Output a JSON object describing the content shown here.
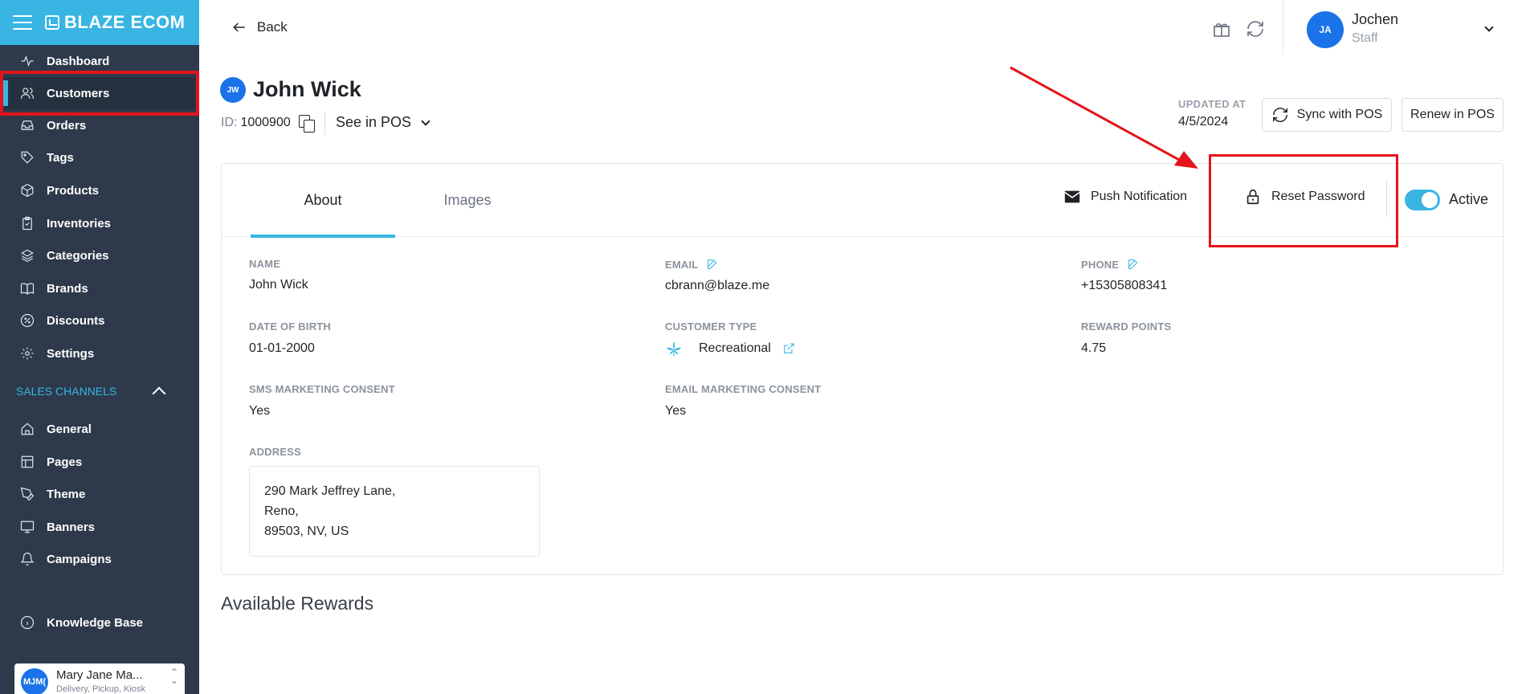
{
  "sidebar": {
    "brand": "BLAZE ECOM",
    "items": [
      {
        "label": "Dashboard",
        "icon": "activity-icon"
      },
      {
        "label": "Customers",
        "icon": "users-icon"
      },
      {
        "label": "Orders",
        "icon": "inbox-icon"
      },
      {
        "label": "Tags",
        "icon": "tag-icon"
      },
      {
        "label": "Products",
        "icon": "box-icon"
      },
      {
        "label": "Inventories",
        "icon": "clipboard-icon"
      },
      {
        "label": "Categories",
        "icon": "layers-icon"
      },
      {
        "label": "Brands",
        "icon": "book-icon"
      },
      {
        "label": "Discounts",
        "icon": "percent-icon"
      },
      {
        "label": "Settings",
        "icon": "gear-icon"
      }
    ],
    "section_label": "SALES CHANNELS",
    "channel_items": [
      {
        "label": "General",
        "icon": "home-icon"
      },
      {
        "label": "Pages",
        "icon": "layout-icon"
      },
      {
        "label": "Theme",
        "icon": "pen-icon"
      },
      {
        "label": "Banners",
        "icon": "monitor-icon"
      },
      {
        "label": "Campaigns",
        "icon": "bell-icon"
      }
    ],
    "knowledge_base": "Knowledge Base",
    "store": {
      "initials": "MJM(",
      "name": "Mary Jane Ma...",
      "subtitle": "Delivery, Pickup, Kiosk"
    }
  },
  "topbar": {
    "back_label": "Back",
    "user": {
      "initials": "JA",
      "name": "Jochen",
      "role": "Staff"
    }
  },
  "customer": {
    "initials": "JW",
    "name": "John Wick",
    "id_label": "ID:",
    "id_value": "1000900",
    "see_in_pos": "See in POS",
    "updated_label": "UPDATED AT",
    "updated_value": "4/5/2024",
    "sync_button": "Sync with POS",
    "renew_button": "Renew in POS"
  },
  "tabs": [
    {
      "label": "About",
      "active": true
    },
    {
      "label": "Images",
      "active": false
    }
  ],
  "actions": {
    "push_notification": "Push Notification",
    "reset_password": "Reset Password",
    "active_label": "Active",
    "active_on": true
  },
  "fields": {
    "name": {
      "label": "NAME",
      "value": "John Wick"
    },
    "email": {
      "label": "EMAIL",
      "value": "cbrann@blaze.me"
    },
    "phone": {
      "label": "PHONE",
      "value": "+15305808341"
    },
    "dob": {
      "label": "DATE OF BIRTH",
      "value": "01-01-2000"
    },
    "customer_type": {
      "label": "CUSTOMER TYPE",
      "value": "Recreational"
    },
    "reward_points": {
      "label": "REWARD POINTS",
      "value": "4.75"
    },
    "sms_consent": {
      "label": "SMS MARKETING CONSENT",
      "value": "Yes"
    },
    "email_consent": {
      "label": "EMAIL MARKETING CONSENT",
      "value": "Yes"
    },
    "address": {
      "label": "ADDRESS",
      "line1": "290 Mark Jeffrey Lane,",
      "line2": "Reno,",
      "line3": "89503, NV, US"
    }
  },
  "rewards_title": "Available Rewards",
  "colors": {
    "accent": "#38b5e3",
    "sidebar": "#2e3a4b",
    "avatar": "#1a73e8",
    "annotation": "#e3141b"
  }
}
